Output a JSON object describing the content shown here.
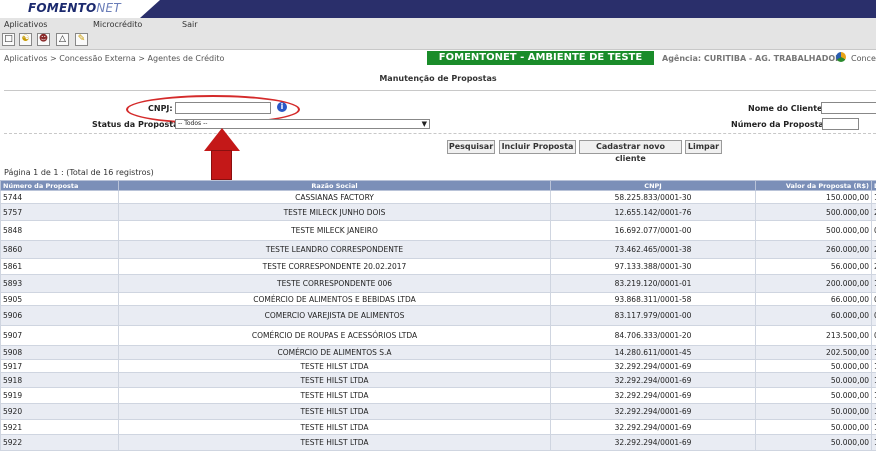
{
  "app": {
    "logo_main": "FOMENTO",
    "logo_sub": "NET"
  },
  "menu": {
    "items": [
      {
        "label": "Aplicativos"
      },
      {
        "label": "Microcrédito"
      },
      {
        "label": "Sair"
      }
    ]
  },
  "toolbar": {
    "icons": [
      "new-document-icon",
      "yin-yang-icon",
      "users-icon",
      "warning-icon",
      "edit-icon"
    ]
  },
  "breadcrumb": "Aplicativos > Concessão Externa > Agentes de Crédito",
  "environment": "FOMENTONET - AMBIENTE DE TESTE",
  "agency": "Agência: CURITIBA - AG. TRABALHADOR",
  "agency_extra": "Conces",
  "page_title": "Manutenção de Propostas",
  "form": {
    "cnpj_label": "CNPJ:",
    "cnpj_value": "",
    "status_label": "Status da Proposta:",
    "status_value": "-- Todos --",
    "cliente_label": "Nome do Cliente:",
    "cliente_value": "",
    "numero_label": "Número da Proposta:",
    "numero_value": ""
  },
  "buttons": {
    "search": "Pesquisar",
    "add_proposal": "Incluir Proposta",
    "new_client": "Cadastrar novo cliente",
    "clear": "Limpar"
  },
  "paging": "Página 1 de 1 : (Total de 16 registros)",
  "table": {
    "columns": [
      "Número da Proposta",
      "Razão Social",
      "CNPJ",
      "Valor da Proposta (R$)",
      "D"
    ],
    "rows": [
      {
        "num": "5744",
        "razao": "CASSIANAS FACTORY",
        "cnpj": "58.225.833/0001-30",
        "valor": "150.000,00",
        "d": "1"
      },
      {
        "num": "5757",
        "razao": "TESTE MILECK JUNHO DOIS",
        "cnpj": "12.655.142/0001-76",
        "valor": "500.000,00",
        "d": "2"
      },
      {
        "num": "5848",
        "razao": "TESTE MILECK JANEIRO",
        "cnpj": "16.692.077/0001-00",
        "valor": "500.000,00",
        "d": "0"
      },
      {
        "num": "5860",
        "razao": "TESTE LEANDRO CORRESPONDENTE",
        "cnpj": "73.462.465/0001-38",
        "valor": "260.000,00",
        "d": "2"
      },
      {
        "num": "5861",
        "razao": "TESTE CORRESPONDENTE 20.02.2017",
        "cnpj": "97.133.388/0001-30",
        "valor": "56.000,00",
        "d": "2"
      },
      {
        "num": "5893",
        "razao": "TESTE CORRESPONDENTE 006",
        "cnpj": "83.219.120/0001-01",
        "valor": "200.000,00",
        "d": "1"
      },
      {
        "num": "5905",
        "razao": "COMÉRCIO DE ALIMENTOS E BEBIDAS LTDA",
        "cnpj": "93.868.311/0001-58",
        "valor": "66.000,00",
        "d": "0"
      },
      {
        "num": "5906",
        "razao": "COMERCIO VAREJISTA DE ALIMENTOS",
        "cnpj": "83.117.979/0001-00",
        "valor": "60.000,00",
        "d": "0"
      },
      {
        "num": "5907",
        "razao": "COMÉRCIO DE ROUPAS E ACESSÓRIOS LTDA",
        "cnpj": "84.706.333/0001-20",
        "valor": "213.500,00",
        "d": "0"
      },
      {
        "num": "5908",
        "razao": "COMÉRCIO DE ALIMENTOS S.A",
        "cnpj": "14.280.611/0001-45",
        "valor": "202.500,00",
        "d": "1"
      },
      {
        "num": "5917",
        "razao": "TESTE HILST LTDA",
        "cnpj": "32.292.294/0001-69",
        "valor": "50.000,00",
        "d": "1"
      },
      {
        "num": "5918",
        "razao": "TESTE HILST LTDA",
        "cnpj": "32.292.294/0001-69",
        "valor": "50.000,00",
        "d": "1"
      },
      {
        "num": "5919",
        "razao": "TESTE HILST LTDA",
        "cnpj": "32.292.294/0001-69",
        "valor": "50.000,00",
        "d": "1"
      },
      {
        "num": "5920",
        "razao": "TESTE HILST LTDA",
        "cnpj": "32.292.294/0001-69",
        "valor": "50.000,00",
        "d": "1"
      },
      {
        "num": "5921",
        "razao": "TESTE HILST LTDA",
        "cnpj": "32.292.294/0001-69",
        "valor": "50.000,00",
        "d": "1"
      },
      {
        "num": "5922",
        "razao": "TESTE HILST LTDA",
        "cnpj": "32.292.294/0001-69",
        "valor": "50.000,00",
        "d": "1"
      }
    ]
  }
}
